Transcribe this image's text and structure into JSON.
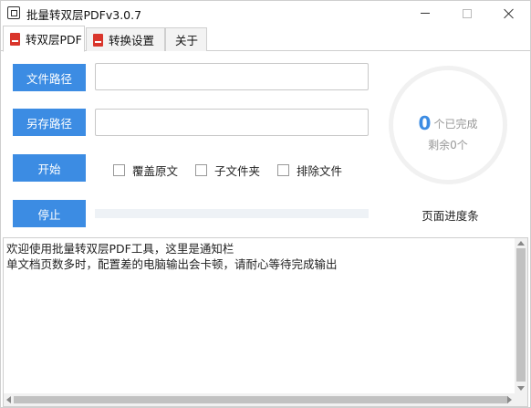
{
  "window": {
    "title": "批量转双层PDFv3.0.7"
  },
  "tabs": [
    {
      "label": "转双层PDF",
      "icon": "pdf-icon",
      "active": true
    },
    {
      "label": "转换设置",
      "icon": "pdf-icon",
      "active": false
    },
    {
      "label": "关于",
      "icon": "",
      "active": false
    }
  ],
  "form": {
    "file_path_button": "文件路径",
    "file_path_value": "",
    "save_path_button": "另存路径",
    "save_path_value": "",
    "start_button": "开始",
    "stop_button": "停止"
  },
  "options": [
    {
      "label": "覆盖原文",
      "checked": false
    },
    {
      "label": "子文件夹",
      "checked": false
    },
    {
      "label": "排除文件",
      "checked": false
    }
  ],
  "progress": {
    "file_progress_percent": 0,
    "completed_count": "0",
    "completed_suffix": "个已完成",
    "remaining_text": "剩余0个",
    "page_progress_label": "页面进度条"
  },
  "log": {
    "lines": [
      "欢迎使用批量转双层PDF工具，这里是通知栏",
      "单文档页数多时，配置差的电脑输出会卡顿，请耐心等待完成输出"
    ]
  },
  "colors": {
    "accent": "#3c8ce3",
    "pdf_icon": "#d9352b"
  }
}
